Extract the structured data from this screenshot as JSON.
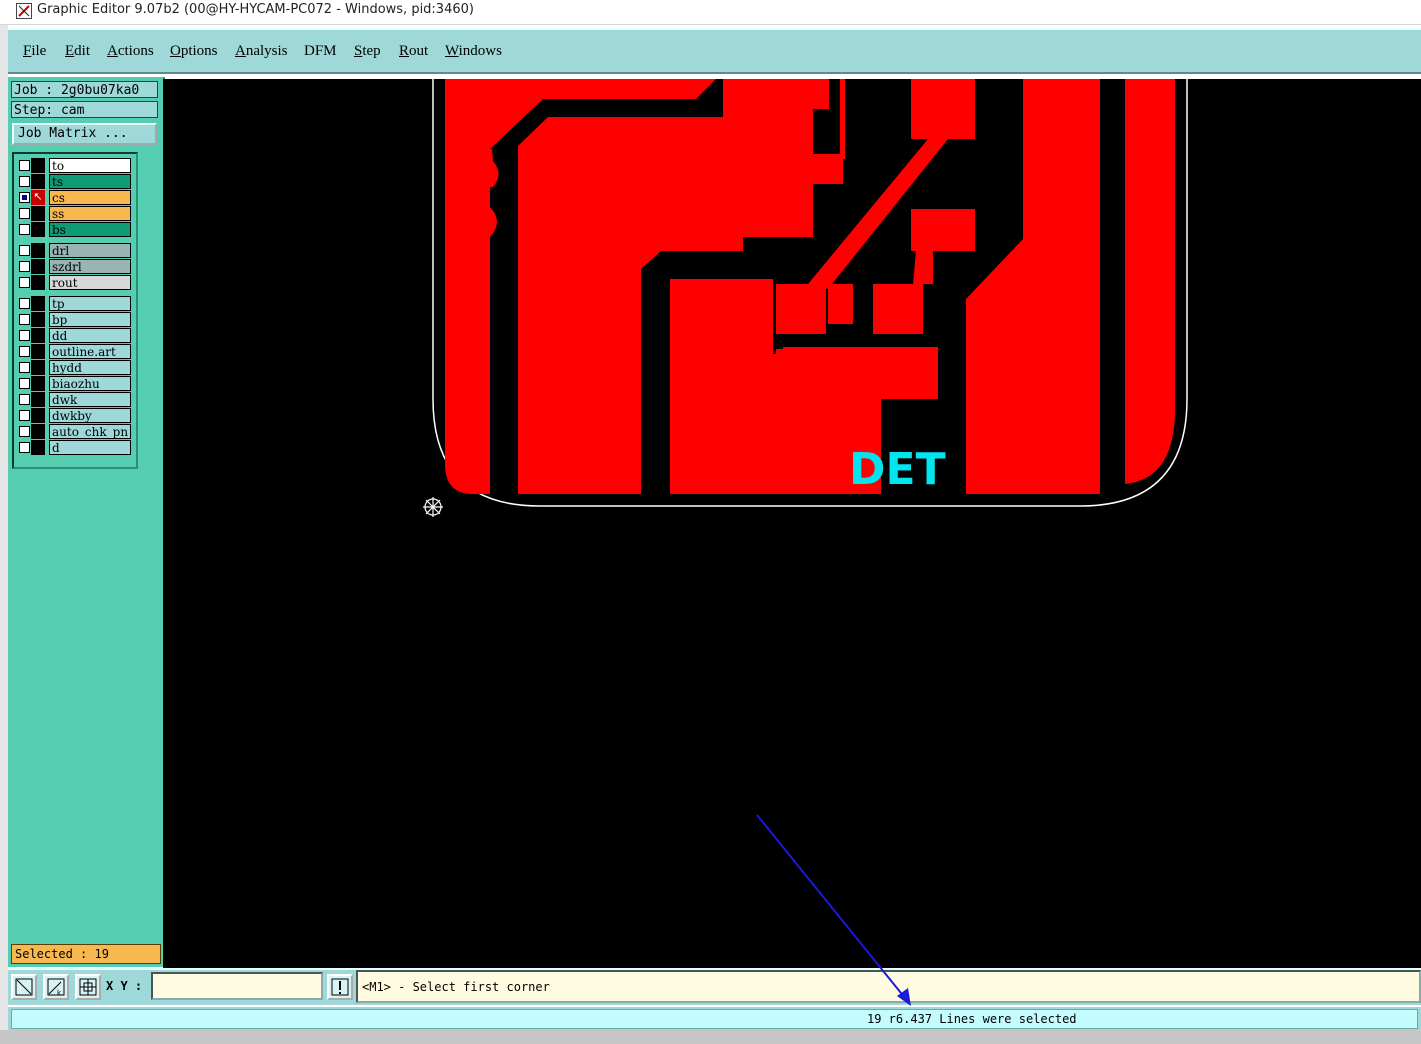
{
  "window": {
    "title": "Graphic Editor 9.07b2 (00@HY-HYCAM-PC072 - Windows, pid:3460)"
  },
  "menu": {
    "items": [
      {
        "mnemonic": "F",
        "rest": "ile"
      },
      {
        "mnemonic": "E",
        "rest": "dit"
      },
      {
        "mnemonic": "A",
        "rest": "ctions"
      },
      {
        "mnemonic": "O",
        "rest": "ptions"
      },
      {
        "mnemonic": "A",
        "rest": "nalysis"
      },
      {
        "mnemonic": "",
        "rest": "DFM"
      },
      {
        "mnemonic": "S",
        "rest": "tep"
      },
      {
        "mnemonic": "R",
        "rest": "out"
      },
      {
        "mnemonic": "W",
        "rest": "indows"
      }
    ]
  },
  "panel": {
    "job": "Job : 2g0bu07ka0",
    "step": "Step: cam",
    "job_matrix": "Job Matrix ...",
    "selected": "Selected : 19"
  },
  "layers": [
    {
      "name": "to",
      "color": "#ffffff",
      "active": false
    },
    {
      "name": "ts",
      "color": "#0d9b73",
      "active": false
    },
    {
      "name": "cs",
      "color": "#f6b84f",
      "active": true
    },
    {
      "name": "ss",
      "color": "#f6b84f",
      "active": false
    },
    {
      "name": "bs",
      "color": "#0d9b73",
      "active": false
    },
    {
      "name": "drl",
      "color": "#9ab4b4",
      "active": false
    },
    {
      "name": "szdrl",
      "color": "#9ab4b4",
      "active": false
    },
    {
      "name": "rout",
      "color": "#d8d8d8",
      "active": false
    },
    {
      "name": "tp",
      "color": "#9fd8d8",
      "active": false
    },
    {
      "name": "bp",
      "color": "#9fd8d8",
      "active": false
    },
    {
      "name": "dd",
      "color": "#9fd8d8",
      "active": false
    },
    {
      "name": "outline.art",
      "color": "#9fd8d8",
      "active": false
    },
    {
      "name": "hydd",
      "color": "#9fd8d8",
      "active": false
    },
    {
      "name": "biaozhu",
      "color": "#9fd8d8",
      "active": false
    },
    {
      "name": "dwk",
      "color": "#9fd8d8",
      "active": false
    },
    {
      "name": "dwkby",
      "color": "#9fd8d8",
      "active": false
    },
    {
      "name": "auto_chk_pn",
      "color": "#9fd8d8",
      "active": false
    },
    {
      "name": "d",
      "color": "#9fd8d8",
      "active": false
    }
  ],
  "canvas": {
    "silkscreen_text": "DET",
    "copper_color": "#ff0000",
    "silk_color": "#00e5ee",
    "outline_color": "#ffffff"
  },
  "input": {
    "xy_label": "X Y :",
    "xy_value": "",
    "prompt": "<M1> - Select first corner"
  },
  "status": {
    "message": "19 r6.437 Lines were selected"
  },
  "colors": {
    "menu_bg": "#9fd8d8",
    "panel_bg": "#55cdb0",
    "annotation_arrow": "#1a1ad8"
  }
}
